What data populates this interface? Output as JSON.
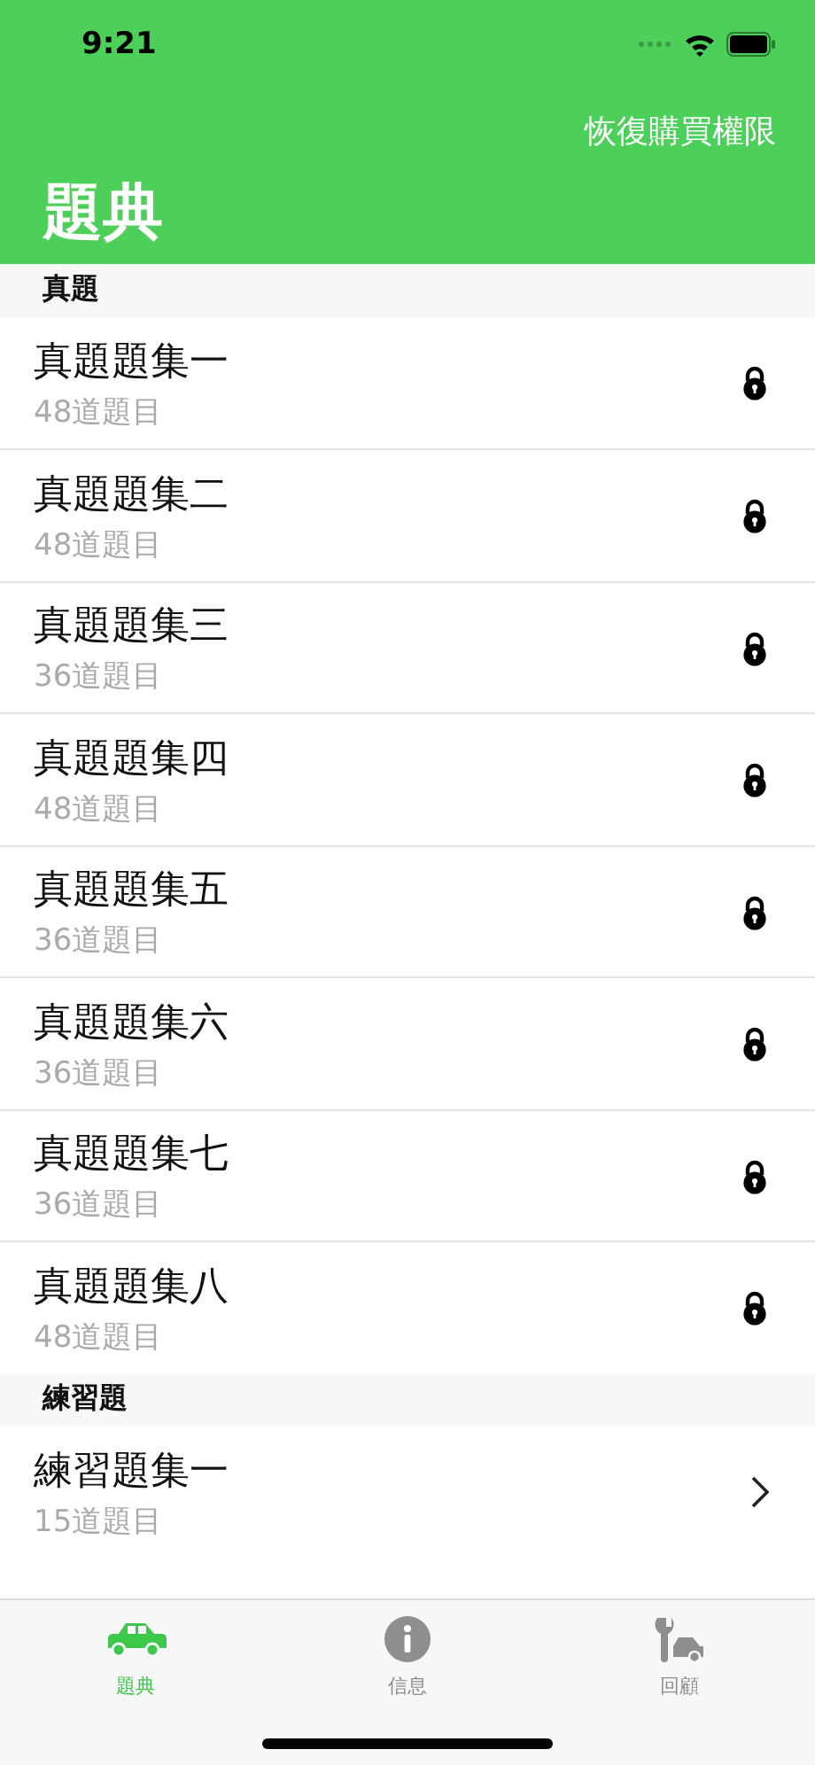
{
  "status_bar": {
    "time": "9:21"
  },
  "nav": {
    "action": "恢復購買權限",
    "title": "題典"
  },
  "sections": [
    {
      "title": "真題",
      "items": [
        {
          "title": "真題題集一",
          "subtitle": "48道題目",
          "kind": "locked"
        },
        {
          "title": "真題題集二",
          "subtitle": "48道題目",
          "kind": "locked"
        },
        {
          "title": "真題題集三",
          "subtitle": "36道題目",
          "kind": "locked"
        },
        {
          "title": "真題題集四",
          "subtitle": "48道題目",
          "kind": "locked"
        },
        {
          "title": "真題題集五",
          "subtitle": "36道題目",
          "kind": "locked"
        },
        {
          "title": "真題題集六",
          "subtitle": "36道題目",
          "kind": "locked"
        },
        {
          "title": "真題題集七",
          "subtitle": "36道題目",
          "kind": "locked"
        },
        {
          "title": "真題題集八",
          "subtitle": "48道題目",
          "kind": "locked"
        }
      ]
    },
    {
      "title": "練習題",
      "items": [
        {
          "title": "練習題集一",
          "subtitle": "15道題目",
          "kind": "open"
        }
      ]
    }
  ],
  "tabs": [
    {
      "label": "題典",
      "kind": "car",
      "selected": true
    },
    {
      "label": "信息",
      "kind": "info",
      "selected": false
    },
    {
      "label": "回顧",
      "kind": "repair",
      "selected": false
    }
  ]
}
